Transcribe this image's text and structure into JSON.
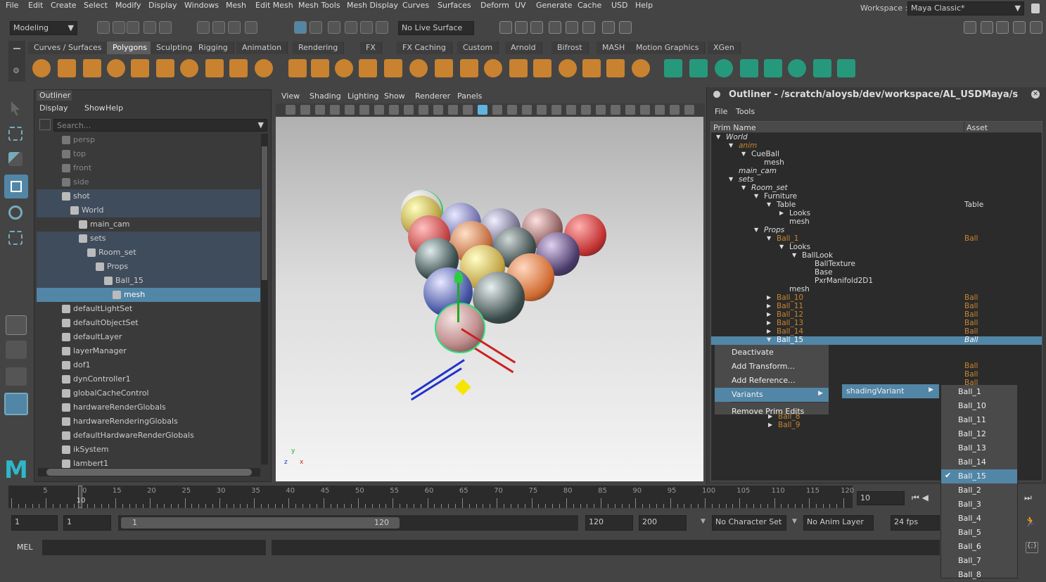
{
  "menubar": {
    "items": [
      "File",
      "Edit",
      "Create",
      "Select",
      "Modify",
      "Display",
      "Windows",
      "Mesh",
      "Edit Mesh",
      "Mesh Tools",
      "Mesh Display",
      "Curves",
      "Surfaces",
      "Deform",
      "UV",
      "Generate",
      "Cache",
      "USD",
      "Help"
    ],
    "workspace_label": "Workspace :",
    "workspace_value": "Maya Classic*"
  },
  "statusline": {
    "mode": "Modeling",
    "live_surface": "No Live Surface"
  },
  "shelf": {
    "tabs": [
      "Curves / Surfaces",
      "Polygons",
      "Sculpting",
      "Rigging",
      "Animation",
      "Rendering",
      "FX",
      "FX Caching",
      "Custom",
      "Arnold",
      "Bifrost",
      "MASH",
      "Motion Graphics",
      "XGen"
    ],
    "active": "Polygons"
  },
  "outliner": {
    "tab": "Outliner",
    "menus": [
      "Display",
      "Show",
      "Help"
    ],
    "search_placeholder": "Search...",
    "rows": [
      {
        "label": "persp",
        "indent": 0,
        "dim": true
      },
      {
        "label": "top",
        "indent": 0,
        "dim": true
      },
      {
        "label": "front",
        "indent": 0,
        "dim": true
      },
      {
        "label": "side",
        "indent": 0,
        "dim": true
      },
      {
        "label": "shot",
        "indent": 0,
        "state": "hl"
      },
      {
        "label": "World",
        "indent": 1,
        "state": "hl"
      },
      {
        "label": "main_cam",
        "indent": 2
      },
      {
        "label": "sets",
        "indent": 2,
        "state": "hl"
      },
      {
        "label": "Room_set",
        "indent": 3,
        "state": "hl"
      },
      {
        "label": "Props",
        "indent": 4,
        "state": "hl"
      },
      {
        "label": "Ball_15",
        "indent": 5,
        "state": "hl"
      },
      {
        "label": "mesh",
        "indent": 6,
        "state": "sel"
      },
      {
        "label": "defaultLightSet",
        "indent": 0
      },
      {
        "label": "defaultObjectSet",
        "indent": 0
      },
      {
        "label": "defaultLayer",
        "indent": 0
      },
      {
        "label": "layerManager",
        "indent": 0
      },
      {
        "label": "dof1",
        "indent": 0
      },
      {
        "label": "dynController1",
        "indent": 0
      },
      {
        "label": "globalCacheControl",
        "indent": 0
      },
      {
        "label": "hardwareRenderGlobals",
        "indent": 0
      },
      {
        "label": "hardwareRenderingGlobals",
        "indent": 0
      },
      {
        "label": "defaultHardwareRenderGlobals",
        "indent": 0
      },
      {
        "label": "ikSystem",
        "indent": 0
      },
      {
        "label": "lambert1",
        "indent": 0
      }
    ]
  },
  "viewport": {
    "menus": [
      "View",
      "Shading",
      "Lighting",
      "Show",
      "Renderer",
      "Panels"
    ]
  },
  "usd_outliner": {
    "title": "Outliner - /scratch/aloysb/dev/workspace/AL_USDMaya/s",
    "menus": [
      "File",
      "Tools"
    ],
    "col_prim": "Prim Name",
    "col_asset": "Asset",
    "rows": [
      {
        "name": "World",
        "indent": 0,
        "italic": true,
        "arrow": "down",
        "asset": ""
      },
      {
        "name": "anim",
        "indent": 1,
        "italic": true,
        "orange": true,
        "arrow": "down",
        "asset": ""
      },
      {
        "name": "CueBall",
        "indent": 2,
        "arrow": "down",
        "asset": ""
      },
      {
        "name": "mesh",
        "indent": 3,
        "asset": ""
      },
      {
        "name": "main_cam",
        "indent": 1,
        "italic": true,
        "asset": ""
      },
      {
        "name": "sets",
        "indent": 1,
        "italic": true,
        "arrow": "down",
        "asset": ""
      },
      {
        "name": "Room_set",
        "indent": 2,
        "italic": true,
        "arrow": "down",
        "asset": ""
      },
      {
        "name": "Furniture",
        "indent": 3,
        "arrow": "down",
        "asset": ""
      },
      {
        "name": "Table",
        "indent": 4,
        "arrow": "down",
        "asset": "Table"
      },
      {
        "name": "Looks",
        "indent": 5,
        "arrow": "right",
        "asset": ""
      },
      {
        "name": "mesh",
        "indent": 5,
        "asset": ""
      },
      {
        "name": "Props",
        "indent": 3,
        "italic": true,
        "arrow": "down",
        "asset": ""
      },
      {
        "name": "Ball_1",
        "indent": 4,
        "orange": true,
        "arrow": "down",
        "asset": "Ball"
      },
      {
        "name": "Looks",
        "indent": 5,
        "arrow": "down",
        "asset": ""
      },
      {
        "name": "BallLook",
        "indent": 6,
        "arrow": "down",
        "asset": ""
      },
      {
        "name": "BallTexture",
        "indent": 7,
        "asset": ""
      },
      {
        "name": "Base",
        "indent": 7,
        "asset": ""
      },
      {
        "name": "PxrManifold2D1",
        "indent": 7,
        "asset": ""
      },
      {
        "name": "mesh",
        "indent": 5,
        "asset": ""
      },
      {
        "name": "Ball_10",
        "indent": 4,
        "orange": true,
        "arrow": "right",
        "asset": "Ball"
      },
      {
        "name": "Ball_11",
        "indent": 4,
        "orange": true,
        "arrow": "right",
        "asset": "Ball"
      },
      {
        "name": "Ball_12",
        "indent": 4,
        "orange": true,
        "arrow": "right",
        "asset": "Ball"
      },
      {
        "name": "Ball_13",
        "indent": 4,
        "orange": true,
        "arrow": "right",
        "asset": "Ball"
      },
      {
        "name": "Ball_14",
        "indent": 4,
        "orange": true,
        "arrow": "right",
        "asset": "Ball"
      },
      {
        "name": "Ball_15",
        "indent": 4,
        "orange": true,
        "arrow": "down",
        "asset": "Ball",
        "selected": true
      }
    ],
    "bottom_rows": [
      {
        "name": "Ball_8"
      },
      {
        "name": "Ball_9"
      }
    ],
    "side_assets": [
      "Ball",
      "Ball",
      "Ball"
    ]
  },
  "context_menu": {
    "items": [
      "Deactivate",
      "Add Transform...",
      "Add Reference...",
      "Variants",
      "Remove Prim Edits"
    ],
    "active": "Variants"
  },
  "variant_sets": {
    "items": [
      "shadingVariant"
    ]
  },
  "variants": {
    "items": [
      "Ball_1",
      "Ball_10",
      "Ball_11",
      "Ball_12",
      "Ball_13",
      "Ball_14",
      "Ball_15",
      "Ball_2",
      "Ball_3",
      "Ball_4",
      "Ball_5",
      "Ball_6",
      "Ball_7",
      "Ball_8"
    ],
    "checked": "Ball_15"
  },
  "timeline": {
    "ticks": [
      "5",
      "10",
      "15",
      "20",
      "25",
      "30",
      "35",
      "40",
      "45",
      "50",
      "55",
      "60",
      "65",
      "70",
      "75",
      "80",
      "85",
      "90",
      "95",
      "100",
      "105",
      "110",
      "115",
      "120"
    ],
    "current": "10",
    "current_field": "10"
  },
  "range": {
    "start": "1",
    "anim_start": "1",
    "slider_start": "1",
    "slider_end": "120",
    "end": "120",
    "anim_end": "200",
    "character_set": "No Character Set",
    "anim_layer": "No Anim Layer",
    "fps": "24 fps"
  },
  "commandline": {
    "label": "MEL"
  }
}
